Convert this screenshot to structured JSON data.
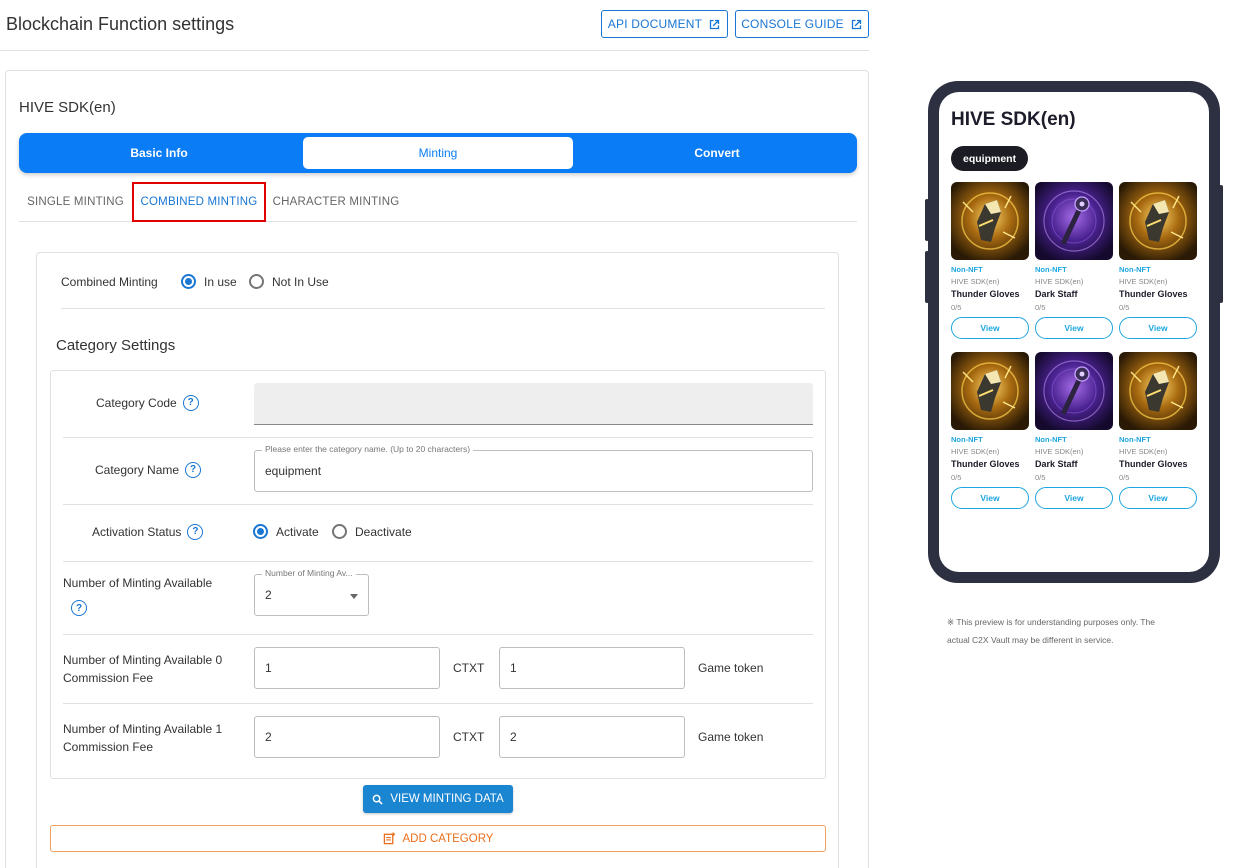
{
  "header": {
    "title": "Blockchain Function settings",
    "api_document": "API DOCUMENT",
    "console_guide": "CONSOLE GUIDE"
  },
  "app": {
    "name": "HIVE SDK(en)"
  },
  "tabs": [
    {
      "label": "Basic Info",
      "active": false
    },
    {
      "label": "Minting",
      "active": true
    },
    {
      "label": "Convert",
      "active": false
    }
  ],
  "subtabs": [
    {
      "label": "SINGLE MINTING",
      "active": false
    },
    {
      "label": "COMBINED MINTING",
      "active": true
    },
    {
      "label": "CHARACTER MINTING",
      "active": false
    }
  ],
  "combined_minting": {
    "label": "Combined Minting",
    "options": [
      "In use",
      "Not In Use"
    ],
    "selected": "In use"
  },
  "category_settings": {
    "title": "Category Settings",
    "code_label": "Category Code",
    "code_value": "",
    "name_label": "Category Name",
    "name_placeholder": "Please enter the category name. (Up to 20 characters)",
    "name_value": "equipment",
    "activation_label": "Activation Status",
    "activation_options": [
      "Activate",
      "Deactivate"
    ],
    "activation_selected": "Activate",
    "count_label": "Number of Minting Available",
    "count_field_label": "Number of Minting Av...",
    "count_value": "2",
    "fees": [
      {
        "label_line1": "Number of Minting Available 0",
        "label_line2": "Commission Fee",
        "ctxt_value": "1",
        "ctxt_unit": "CTXT",
        "token_value": "1",
        "token_unit": "Game token"
      },
      {
        "label_line1": "Number of Minting Available 1",
        "label_line2": "Commission Fee",
        "ctxt_value": "2",
        "ctxt_unit": "CTXT",
        "token_value": "2",
        "token_unit": "Game token"
      }
    ],
    "view_minting_data": "VIEW MINTING DATA",
    "add_category": "ADD CATEGORY"
  },
  "preview": {
    "title": "HIVE SDK(en)",
    "chip": "equipment",
    "items": [
      {
        "type": "Non-NFT",
        "sdk": "HIVE SDK(en)",
        "name": "Thunder Gloves",
        "count": "0/5",
        "view": "View",
        "art": "gloves"
      },
      {
        "type": "Non-NFT",
        "sdk": "HIVE SDK(en)",
        "name": "Dark Staff",
        "count": "0/5",
        "view": "View",
        "art": "staff"
      },
      {
        "type": "Non-NFT",
        "sdk": "HIVE SDK(en)",
        "name": "Thunder Gloves",
        "count": "0/5",
        "view": "View",
        "art": "gloves"
      },
      {
        "type": "Non-NFT",
        "sdk": "HIVE SDK(en)",
        "name": "Thunder Gloves",
        "count": "0/5",
        "view": "View",
        "art": "gloves"
      },
      {
        "type": "Non-NFT",
        "sdk": "HIVE SDK(en)",
        "name": "Dark Staff",
        "count": "0/5",
        "view": "View",
        "art": "staff"
      },
      {
        "type": "Non-NFT",
        "sdk": "HIVE SDK(en)",
        "name": "Thunder Gloves",
        "count": "0/5",
        "view": "View",
        "art": "gloves"
      }
    ],
    "note_line1": "※ This preview is for understanding purposes only. The",
    "note_line2": "actual C2X Vault may be different in service."
  },
  "colors": {
    "primary": "#0a7cf5",
    "accent_orange": "#ea6e1b",
    "highlight_red": "#e00000",
    "preview_link": "#1da6e0"
  }
}
